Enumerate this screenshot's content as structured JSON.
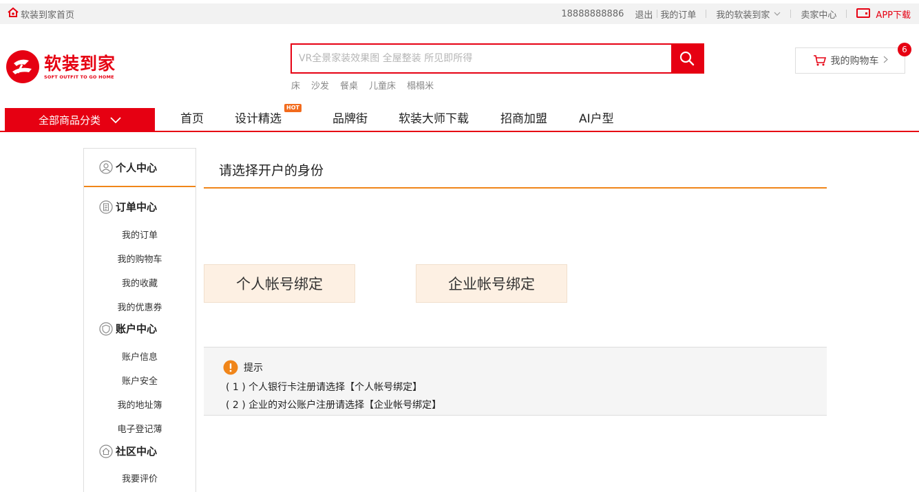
{
  "topbar": {
    "home_link": "软装到家首页",
    "phone": "18888888886",
    "logout": "退出",
    "my_orders": "我的订单",
    "my_account": "我的软装到家",
    "seller_center": "卖家中心",
    "app_download": "APP下载"
  },
  "logo": {
    "name_cn": "软装到家",
    "name_en": "SOFT OUTFIT TO GO HOME"
  },
  "search": {
    "placeholder": "VR全景家装效果图 全屋整装 所见即所得",
    "hot_words": [
      "床",
      "沙发",
      "餐桌",
      "儿童床",
      "榻榻米"
    ]
  },
  "cart": {
    "label": "我的购物车",
    "count": "6"
  },
  "nav": {
    "all_categories": "全部商品分类",
    "items": [
      "首页",
      "设计精选",
      "品牌街",
      "软装大师下载",
      "招商加盟",
      "AI户型"
    ],
    "hot_badge": "HOT"
  },
  "sidebar": {
    "personal_center": "个人中心",
    "order_center": "订单中心",
    "order_items": [
      "我的订单",
      "我的购物车",
      "我的收藏",
      "我的优惠券"
    ],
    "account_center": "账户中心",
    "account_items": [
      "账户信息",
      "账户安全",
      "我的地址簿",
      "电子登记薄"
    ],
    "community_center": "社区中心",
    "community_items": [
      "我要评价"
    ]
  },
  "main": {
    "title": "请选择开户的身份",
    "personal_bind": "个人帐号绑定",
    "company_bind": "企业帐号绑定",
    "tips": {
      "heading": "提示",
      "line1": "( 1 ) 个人银行卡注册请选择【个人帐号绑定】",
      "line2": "( 2 ) 企业的对公账户注册请选择【企业帐号绑定】"
    }
  },
  "colors": {
    "brand_red": "#e60012",
    "accent_orange": "#f08519",
    "button_bg": "#fdf0e3"
  }
}
